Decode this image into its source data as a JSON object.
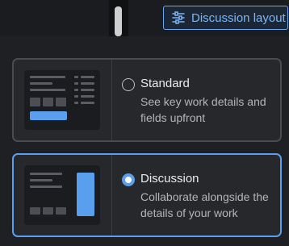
{
  "header": {
    "layout_button_label": "Discussion layout",
    "layout_button_icon": "sliders-icon",
    "accent_color": "#6aa7f0"
  },
  "options": [
    {
      "title": "Standard",
      "description": "See key work details and fields upfront",
      "selected": false
    },
    {
      "title": "Discussion",
      "description": "Collaborate alongside the details of your work",
      "selected": true
    }
  ],
  "colors": {
    "background": "#1f2023",
    "card": "#27282c",
    "selected_border": "#5a9fee",
    "accent_block": "#5a9fee"
  }
}
